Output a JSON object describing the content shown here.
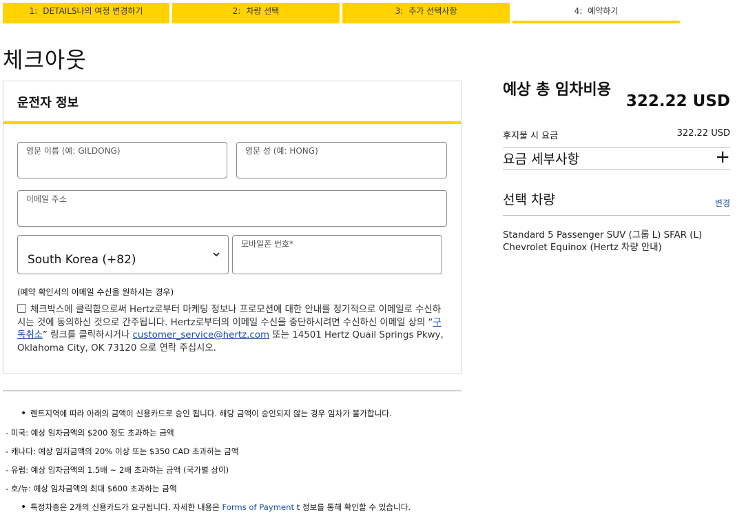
{
  "steps": [
    {
      "num": "1:",
      "label": "DETAILS나의 여정 변경하기"
    },
    {
      "num": "2:",
      "label": "차량 선택"
    },
    {
      "num": "3:",
      "label": "추가 선택사항"
    },
    {
      "num": "4:",
      "label": "예약하기"
    }
  ],
  "page_title": "체크아웃",
  "driver": {
    "heading": "운전자 정보",
    "first_name_label": "영문 이름 (예: GILDONG)",
    "first_name_value": "",
    "last_name_label": "영문 성 (예: HONG)",
    "last_name_value": "",
    "email_label": "이메일 주소",
    "email_value": "",
    "country_select": "South Korea (+82)",
    "mobile_label": "모바일폰 번호*",
    "mobile_value": "",
    "confirm_note": "(예약 확인서의 이메일 수신을 원하시는 경우)",
    "consent_before": "체크박스에 클릭함으로써 Hertz로부터 마케팅 정보나 프로모션에 대한 안내를 정기적으로 이메일로 수신하시는 것에 동의하신 것으로 간주됩니다. Hertz로부터의 이메일 수신을 중단하시려면 수신하신 이메일 상의 “",
    "unsubscribe_link": "구독취소",
    "consent_middle": "” 링크를 클릭하시거나 ",
    "email_link": "customer_service@hertz.com",
    "consent_after": " 또는 14501 Hertz Quail Springs Pkwy, Oklahoma City, OK 73120 으로 연락 주십시오."
  },
  "notes": {
    "bullet1": "렌트지역에 따라 아래의 금액이 신용카드로 승인 됩니다. 해당 금액이 승인되지 않는 경우 임차가 불가합니다.",
    "region_lines": [
      "- 미국: 예상 임차금액의 $200 정도 초과하는 금액",
      "- 캐나다: 예상 임차금액의 20% 이상 또는 $350 CAD 초과하는 금액",
      "- 유럽: 예상 임차금액의 1.5배 ~ 2배 초과하는 금액 (국가별 상이)",
      "- 호/뉴: 예상 임차금액의 최대 $600 초과하는 금액"
    ],
    "bullet2_before": "특정차종은 2개의 신용카드가 요구됩니다. 자세한 내용은 ",
    "bullet2_link": "Forms of Payment",
    "bullet2_after": " t 정보를 통해 확인할 수 있습니다."
  },
  "summary": {
    "title": "예상 총 임차비용",
    "total": "322.22 USD",
    "pay_later_label": "후지불 시 요금",
    "pay_later_amount": "322.22 USD",
    "rate_details": "요금 세부사항",
    "expand_symbol": "+",
    "vehicle_heading": "선택 차량",
    "change_link": "변경",
    "vehicle_desc": "Standard 5 Passenger SUV (그룹 L) SFAR (L) Chevrolet Equinox (Hertz 차량 안내)"
  },
  "colors": {
    "accent": "#ffd200",
    "link": "#1a4ea3",
    "border": "#8a8a8a"
  },
  "icons": {
    "dropdown": "chevron-down-icon",
    "expand": "plus-icon",
    "checkbox": "checkbox-icon"
  }
}
